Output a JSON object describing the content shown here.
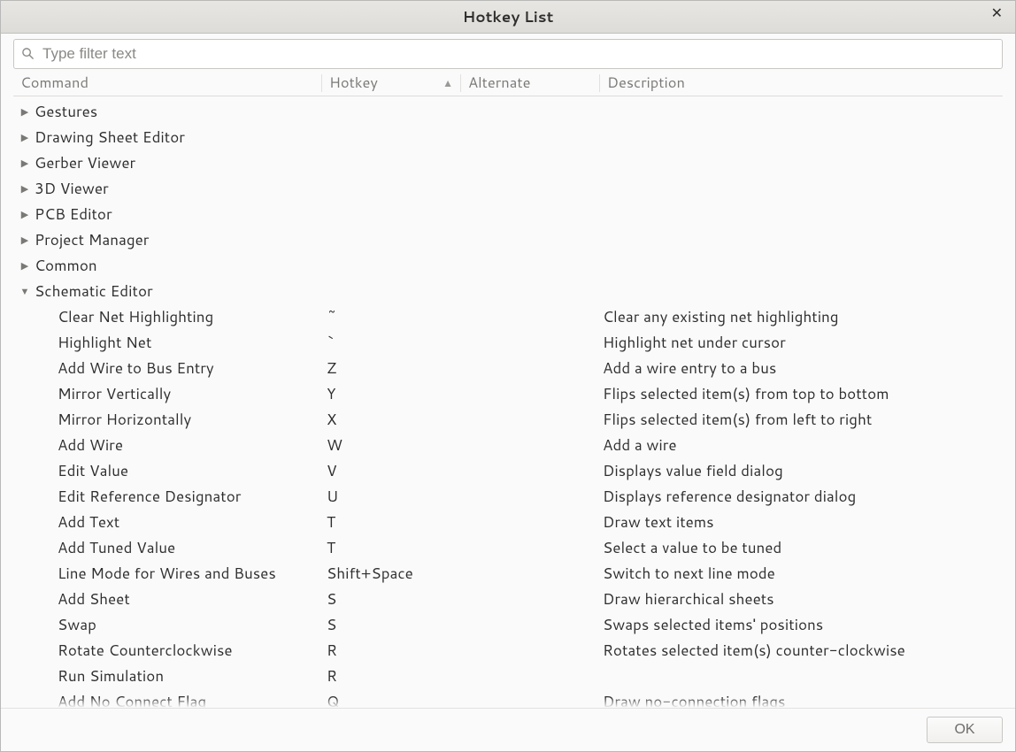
{
  "window": {
    "title": "Hotkey List"
  },
  "filter": {
    "placeholder": "Type filter text",
    "value": ""
  },
  "columns": {
    "command": "Command",
    "hotkey": "Hotkey",
    "alternate": "Alternate",
    "description": "Description"
  },
  "sort": {
    "column": "hotkey",
    "direction": "asc"
  },
  "categories": [
    {
      "label": "Gestures",
      "expanded": false
    },
    {
      "label": "Drawing Sheet Editor",
      "expanded": false
    },
    {
      "label": "Gerber Viewer",
      "expanded": false
    },
    {
      "label": "3D Viewer",
      "expanded": false
    },
    {
      "label": "PCB Editor",
      "expanded": false
    },
    {
      "label": "Project Manager",
      "expanded": false
    },
    {
      "label": "Common",
      "expanded": false
    },
    {
      "label": "Schematic Editor",
      "expanded": true,
      "items": [
        {
          "command": "Clear Net Highlighting",
          "hotkey": "~",
          "alternate": "",
          "description": "Clear any existing net highlighting"
        },
        {
          "command": "Highlight Net",
          "hotkey": "`",
          "alternate": "",
          "description": "Highlight net under cursor"
        },
        {
          "command": "Add Wire to Bus Entry",
          "hotkey": "Z",
          "alternate": "",
          "description": "Add a wire entry to a bus"
        },
        {
          "command": "Mirror Vertically",
          "hotkey": "Y",
          "alternate": "",
          "description": "Flips selected item(s) from top to bottom"
        },
        {
          "command": "Mirror Horizontally",
          "hotkey": "X",
          "alternate": "",
          "description": "Flips selected item(s) from left to right"
        },
        {
          "command": "Add Wire",
          "hotkey": "W",
          "alternate": "",
          "description": "Add a wire"
        },
        {
          "command": "Edit Value",
          "hotkey": "V",
          "alternate": "",
          "description": "Displays value field dialog"
        },
        {
          "command": "Edit Reference Designator",
          "hotkey": "U",
          "alternate": "",
          "description": "Displays reference designator dialog"
        },
        {
          "command": "Add Text",
          "hotkey": "T",
          "alternate": "",
          "description": "Draw text items"
        },
        {
          "command": "Add Tuned Value",
          "hotkey": "T",
          "alternate": "",
          "description": "Select a value to be tuned"
        },
        {
          "command": "Line Mode for Wires and Buses",
          "hotkey": "Shift+Space",
          "alternate": "",
          "description": "Switch to next line mode"
        },
        {
          "command": "Add Sheet",
          "hotkey": "S",
          "alternate": "",
          "description": "Draw hierarchical sheets"
        },
        {
          "command": "Swap",
          "hotkey": "S",
          "alternate": "",
          "description": "Swaps selected items' positions"
        },
        {
          "command": "Rotate Counterclockwise",
          "hotkey": "R",
          "alternate": "",
          "description": "Rotates selected item(s) counter-clockwise"
        },
        {
          "command": "Run Simulation",
          "hotkey": "R",
          "alternate": "",
          "description": ""
        },
        {
          "command": "Add No Connect Flag",
          "hotkey": "Q",
          "alternate": "",
          "description": "Draw no-connection flags"
        }
      ]
    }
  ],
  "buttons": {
    "ok": "OK"
  }
}
